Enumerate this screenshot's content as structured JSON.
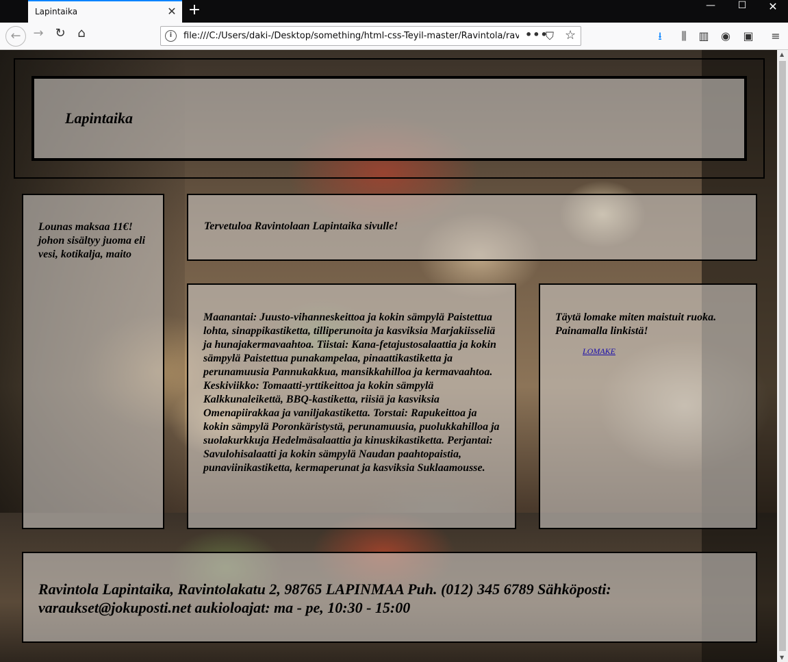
{
  "browser": {
    "tab_title": "Lapintaika",
    "tab_close": "✕",
    "new_tab": "+",
    "url": "file:///C:/Users/daki-/Desktop/something/html-css-Teyil-master/Ravintola/ravintola.html",
    "url_more": "•••",
    "window_buttons": {
      "minimize": "—",
      "maximize": "☐",
      "close": "✕"
    },
    "nav": {
      "back": "←",
      "forward": "→",
      "reload": "↻",
      "home": "⌂"
    },
    "toolbar_icons": {
      "download": "⭳",
      "library": "⫼",
      "sidebar": "▥",
      "account": "◉",
      "extension": "▣",
      "menu": "≡",
      "pocket": "⛉",
      "star": "☆",
      "info": "i"
    }
  },
  "page": {
    "header": {
      "title": "Lapintaika"
    },
    "sidebar": {
      "text": "Lounas maksaa 11€! johon sisältyy juoma eli vesi, kotikalja, maito"
    },
    "welcome": {
      "text": "Tervetuloa Ravintolaan Lapintaika sivulle!"
    },
    "menu": {
      "text": "Maanantai: Juusto-vihanneskeittoa ja kokin sämpylä Paistettua lohta, sinappikastiketta, tilliperunoita ja kasviksia Marjakiisseliä ja hunajakermavaahtoa. Tiistai: Kana-fetajustosalaattia ja kokin sämpylä Paistettua punakampelaa, pinaattikastiketta ja perunamuusia Pannukakkua, mansikkahilloa ja kermavaahtoa. Keskiviikko: Tomaatti-yrttikeittoa ja kokin sämpylä Kalkkunaleikettä, BBQ-kastiketta, riisiä ja kasviksia Omenapiirakkaa ja vaniljakastiketta. Torstai: Rapukeittoa ja kokin sämpylä Poronkäristystä, perunamuusia, puolukkahilloa ja suolakurkkuja Hedelmäsalaattia ja kinuskikastiketta. Perjantai: Savulohisalaatti ja kokin sämpylä Naudan paahtopaistia, punaviinikastiketta, kermaperunat ja kasviksia Suklaamousse."
    },
    "form": {
      "text": "Täytä lomake miten maistuit ruoka. Painamalla linkistä!",
      "link_label": "LOMAKE"
    },
    "footer": {
      "text": "Ravintola Lapintaika, Ravintolakatu 2, 98765 LAPINMAA Puh. (012) 345 6789 Sähköposti: varaukset@jokuposti.net aukioloajat: ma - pe, 10:30 - 15:00"
    }
  }
}
